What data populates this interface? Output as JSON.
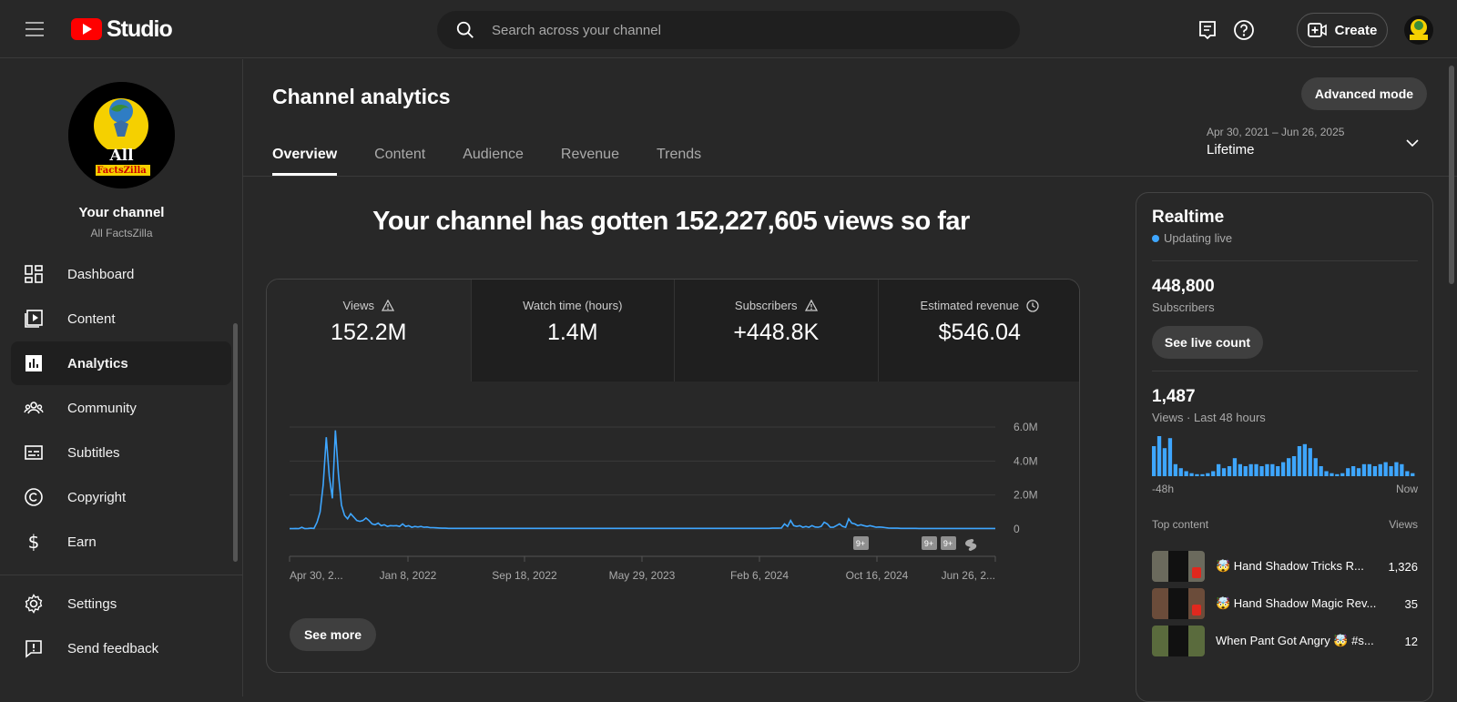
{
  "topbar": {
    "logo_text": "Studio",
    "search_placeholder": "Search across your channel",
    "create_label": "Create"
  },
  "sidebar": {
    "channel_title": "Your channel",
    "channel_name": "All FactsZilla",
    "avatar_text_top": "All",
    "avatar_text_bottom": "FactsZilla",
    "items": [
      {
        "label": "Dashboard",
        "icon": "dashboard-icon"
      },
      {
        "label": "Content",
        "icon": "content-icon"
      },
      {
        "label": "Analytics",
        "icon": "analytics-icon",
        "active": true
      },
      {
        "label": "Community",
        "icon": "community-icon"
      },
      {
        "label": "Subtitles",
        "icon": "subtitles-icon"
      },
      {
        "label": "Copyright",
        "icon": "copyright-icon"
      },
      {
        "label": "Earn",
        "icon": "earn-icon"
      },
      {
        "label": "Settings",
        "icon": "settings-icon"
      },
      {
        "label": "Send feedback",
        "icon": "feedback-icon"
      }
    ]
  },
  "main": {
    "title": "Channel analytics",
    "advanced_mode": "Advanced mode",
    "tabs": [
      "Overview",
      "Content",
      "Audience",
      "Revenue",
      "Trends"
    ],
    "date_range": "Apr 30, 2021 – Jun 26, 2025",
    "date_label": "Lifetime",
    "headline": "Your channel has gotten 152,227,605 views so far",
    "metrics": [
      {
        "label": "Views",
        "value": "152.2M",
        "icon": "warning-icon"
      },
      {
        "label": "Watch time (hours)",
        "value": "1.4M"
      },
      {
        "label": "Subscribers",
        "value": "+448.8K",
        "icon": "warning-icon"
      },
      {
        "label": "Estimated revenue",
        "value": "$546.04",
        "icon": "clock-icon"
      }
    ],
    "see_more": "See more"
  },
  "chart_data": {
    "type": "line",
    "series": [
      {
        "values": [
          0.02,
          0.02,
          0.03,
          0.02,
          0.1,
          0.02,
          0.03,
          0.05,
          0.03,
          0.4,
          1.0,
          2.6,
          5.4,
          3.1,
          1.8,
          5.8,
          3.2,
          1.4,
          0.8,
          0.6,
          0.9,
          0.7,
          0.5,
          0.45,
          0.5,
          0.65,
          0.5,
          0.3,
          0.25,
          0.35,
          0.2,
          0.25,
          0.15,
          0.2,
          0.18,
          0.2,
          0.15,
          0.3,
          0.15,
          0.2,
          0.1,
          0.15,
          0.12,
          0.15,
          0.1,
          0.12,
          0.08,
          0.08,
          0.07,
          0.06,
          0.05,
          0.05,
          0.04,
          0.04,
          0.04,
          0.04,
          0.04,
          0.04,
          0.04,
          0.04,
          0.04,
          0.04,
          0.04,
          0.04,
          0.04,
          0.04,
          0.04,
          0.04,
          0.04,
          0.04,
          0.04,
          0.04,
          0.04,
          0.04,
          0.04,
          0.04,
          0.04,
          0.04,
          0.04,
          0.04,
          0.04,
          0.04,
          0.04,
          0.04,
          0.04,
          0.04,
          0.04,
          0.04,
          0.04,
          0.04,
          0.04,
          0.04,
          0.04,
          0.04,
          0.04,
          0.04,
          0.04,
          0.04,
          0.04,
          0.04,
          0.04,
          0.04,
          0.04,
          0.04,
          0.04,
          0.04,
          0.04,
          0.04,
          0.04,
          0.04,
          0.04,
          0.04,
          0.04,
          0.04,
          0.04,
          0.04,
          0.04,
          0.04,
          0.04,
          0.04,
          0.04,
          0.04,
          0.04,
          0.04,
          0.04,
          0.04,
          0.04,
          0.04,
          0.04,
          0.04,
          0.04,
          0.04,
          0.04,
          0.04,
          0.04,
          0.04,
          0.04,
          0.04,
          0.04,
          0.04,
          0.04,
          0.04,
          0.04,
          0.04,
          0.04,
          0.04,
          0.04,
          0.04,
          0.04,
          0.04,
          0.04,
          0.04,
          0.04,
          0.04,
          0.04,
          0.04,
          0.04,
          0.04,
          0.05,
          0.05,
          0.05,
          0.06,
          0.3,
          0.15,
          0.5,
          0.2,
          0.15,
          0.2,
          0.1,
          0.15,
          0.1,
          0.2,
          0.12,
          0.1,
          0.15,
          0.4,
          0.3,
          0.1,
          0.1,
          0.2,
          0.3,
          0.15,
          0.1,
          0.6,
          0.35,
          0.3,
          0.2,
          0.25,
          0.2,
          0.15,
          0.2,
          0.15,
          0.1,
          0.12,
          0.1,
          0.08,
          0.06,
          0.05,
          0.05,
          0.05,
          0.04,
          0.04,
          0.04,
          0.04,
          0.04,
          0.04,
          0.03,
          0.03,
          0.03,
          0.03,
          0.03,
          0.03,
          0.03,
          0.03,
          0.03,
          0.03,
          0.03,
          0.03,
          0.03,
          0.03,
          0.03,
          0.03,
          0.03,
          0.03,
          0.03,
          0.03,
          0.03,
          0.03,
          0.03,
          0.03,
          0.03,
          0.03
        ]
      }
    ],
    "x_ticks": [
      "Apr 30, 2...",
      "Jan 8, 2022",
      "Sep 18, 2022",
      "May 29, 2023",
      "Feb 6, 2024",
      "Oct 16, 2024",
      "Jun 26, 2..."
    ],
    "y_ticks": [
      "6.0M",
      "4.0M",
      "2.0M",
      "0"
    ],
    "ylim": [
      0,
      6
    ],
    "markers": [
      "9+",
      "9+",
      "9+"
    ],
    "line_color": "#3ea6ff"
  },
  "realtime": {
    "title": "Realtime",
    "status": "Updating live",
    "subscribers_value": "448,800",
    "subscribers_label": "Subscribers",
    "live_count_button": "See live count",
    "views_value": "1,487",
    "views_label": "Views · Last 48 hours",
    "axis_left": "-48h",
    "axis_right": "Now",
    "bars": [
      30,
      40,
      28,
      38,
      12,
      8,
      5,
      3,
      2,
      2,
      3,
      5,
      12,
      8,
      10,
      18,
      12,
      10,
      12,
      12,
      10,
      12,
      12,
      10,
      14,
      18,
      20,
      30,
      32,
      28,
      18,
      10,
      5,
      3,
      2,
      3,
      8,
      10,
      8,
      12,
      12,
      10,
      12,
      14,
      10,
      14,
      12,
      5,
      3
    ],
    "top_content_label": "Top content",
    "top_views_label": "Views",
    "top_content": [
      {
        "title": "🤯 Hand Shadow Tricks R...",
        "views": "1,326",
        "thumb_color": "#6b6a5d"
      },
      {
        "title": "🤯 Hand Shadow Magic Rev...",
        "views": "35",
        "thumb_color": "#6b4c3a"
      },
      {
        "title": "When Pant Got Angry 🤯 #s...",
        "views": "12",
        "thumb_color": "#5a6b3d"
      }
    ]
  }
}
